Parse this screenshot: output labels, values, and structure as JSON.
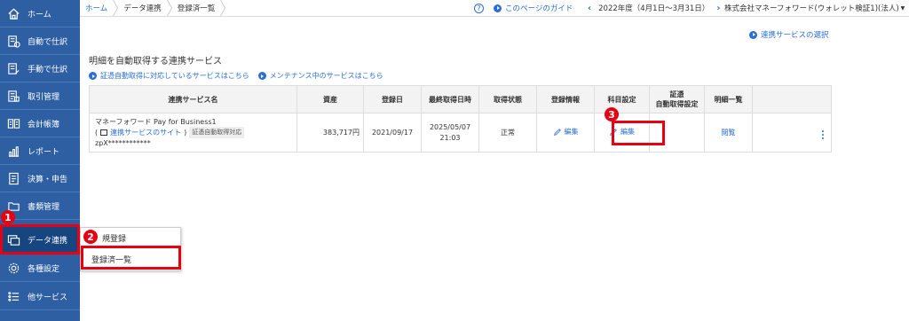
{
  "sidebar": {
    "items": [
      {
        "label": "ホーム",
        "icon": "home-icon"
      },
      {
        "label": "自動で仕訳",
        "icon": "auto-journal-icon"
      },
      {
        "label": "手動で仕訳",
        "icon": "manual-journal-icon"
      },
      {
        "label": "取引管理",
        "icon": "transaction-icon"
      },
      {
        "label": "会計帳簿",
        "icon": "ledger-icon"
      },
      {
        "label": "レポート",
        "icon": "report-icon"
      },
      {
        "label": "決算・申告",
        "icon": "closing-icon"
      },
      {
        "label": "書類管理",
        "icon": "documents-icon"
      },
      {
        "label": "データ連携",
        "icon": "data-link-icon"
      },
      {
        "label": "各種設定",
        "icon": "gear-icon"
      },
      {
        "label": "他サービス",
        "icon": "list-icon"
      }
    ],
    "active_index": 8
  },
  "submenu": {
    "items": [
      "新規登録",
      "登録済一覧"
    ],
    "visible_first_label": "規登録"
  },
  "annotations": {
    "step1": "1",
    "step2": "2",
    "step3": "3",
    "color": "#e60012"
  },
  "breadcrumb": [
    "ホーム",
    "データ連携",
    "登録済一覧"
  ],
  "topbar": {
    "guide": "このページのガイド",
    "fiscal_year": "2022年度（4月1日〜3月31日）",
    "company": "株式会社マネーフォワード(ウォレット検証1)(法人)"
  },
  "select_service_link": "連携サービスの選択",
  "section_title": "明細を自動取得する連携サービス",
  "links": {
    "supported": "証憑自動取得に対応しているサービスはこちら",
    "maintenance": "メンテナンス中のサービスはこちら"
  },
  "table": {
    "headers": [
      "連携サービス名",
      "資産",
      "登録日",
      "最終取得日時",
      "取得状態",
      "登録情報",
      "科目設定",
      "証憑\n自動取得設定",
      "明細一覧",
      ""
    ],
    "rows": [
      {
        "name": "マネーフォワード Pay for Business1",
        "site_link": "連携サービスのサイト",
        "tag": "証憑自動取得対応",
        "account": "zpX************",
        "asset": "383,717円",
        "registered": "2021/09/17",
        "last_fetch_date": "2025/05/07",
        "last_fetch_time": "21:03",
        "status": "正常",
        "reg_info": "編集",
        "account_setting": "編集",
        "voucher_setting": "",
        "detail": "閲覧"
      }
    ]
  },
  "colors": {
    "sidebar": "#2e5fa2",
    "sidebar_active": "#16457f",
    "link": "#2a6fd6",
    "highlight": "#e60012"
  }
}
